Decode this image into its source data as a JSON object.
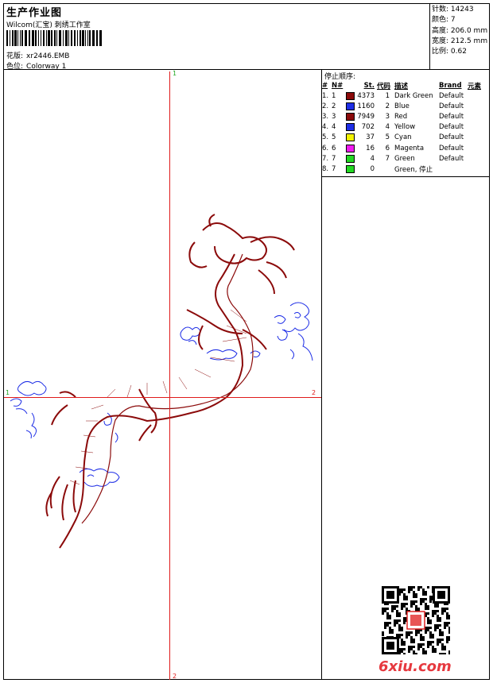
{
  "header": {
    "title": "生产作业图",
    "subtitle": "Wilcom(汇宝) 刺绣工作室",
    "design_label": "花版:",
    "design_value": "xr2446.EMB",
    "colorway_label": "色位:",
    "colorway_value": "Colorway 1"
  },
  "stats": [
    {
      "label": "针数:",
      "value": "14243"
    },
    {
      "label": "颜色:",
      "value": "7"
    },
    {
      "label": "高度:",
      "value": "206.0 mm"
    },
    {
      "label": "宽度:",
      "value": "212.5 mm"
    },
    {
      "label": "比例:",
      "value": "0.62"
    }
  ],
  "color_panel": {
    "title": "停止顺序:",
    "headers": [
      "#",
      "N#",
      "St.",
      "代码",
      "描述",
      "Brand",
      "元素"
    ],
    "rows": [
      {
        "num": "1.",
        "n": "1",
        "color": "#8B0A0A",
        "st": "4373",
        "code": "1",
        "desc": "Dark Green",
        "brand": "Default"
      },
      {
        "num": "2.",
        "n": "2",
        "color": "#1E2EE6",
        "st": "1160",
        "code": "2",
        "desc": "Blue",
        "brand": "Default"
      },
      {
        "num": "3.",
        "n": "3",
        "color": "#8B0A0A",
        "st": "7949",
        "code": "3",
        "desc": "Red",
        "brand": "Default"
      },
      {
        "num": "4.",
        "n": "4",
        "color": "#1E2EE6",
        "st": "702",
        "code": "4",
        "desc": "Yellow",
        "brand": "Default"
      },
      {
        "num": "5.",
        "n": "5",
        "color": "#F2F200",
        "st": "37",
        "code": "5",
        "desc": "Cyan",
        "brand": "Default"
      },
      {
        "num": "6.",
        "n": "6",
        "color": "#F01AF0",
        "st": "16",
        "code": "6",
        "desc": "Magenta",
        "brand": "Default"
      },
      {
        "num": "7.",
        "n": "7",
        "color": "#22D822",
        "st": "4",
        "code": "7",
        "desc": "Green",
        "brand": "Default"
      },
      {
        "num": "8.",
        "n": "7",
        "color": "#22D822",
        "st": "0",
        "code": "",
        "desc": "Green, 停止",
        "brand": ""
      }
    ]
  },
  "axes": {
    "top": "1",
    "bottom": "2",
    "left": "1",
    "right": "2"
  },
  "watermark": "6xiu.com"
}
